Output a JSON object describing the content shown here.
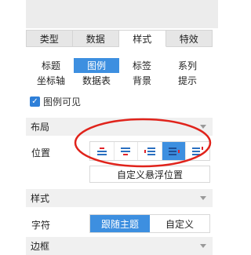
{
  "main_tabs": [
    "类型",
    "数据",
    "样式",
    "特效"
  ],
  "main_tab_active": "样式",
  "sub_tabs": [
    [
      "标题",
      "图例",
      "标签",
      "系列"
    ],
    [
      "坐标轴",
      "数据表",
      "背景",
      "提示"
    ]
  ],
  "sub_tab_active": "图例",
  "legend_visible": {
    "label": "图例可见",
    "checked": true
  },
  "layout_section": {
    "title": "布局",
    "position_label": "位置",
    "position_options": [
      "legend-top-icon",
      "legend-bottom-icon",
      "legend-left-icon",
      "legend-right-icon",
      "legend-top-right-icon"
    ],
    "position_selected": "legend-right-icon",
    "custom_float_label": "自定义悬浮位置"
  },
  "style_section": {
    "title": "样式",
    "font_label": "字符",
    "font_options": [
      "跟随主题",
      "自定义"
    ],
    "font_selected": "跟随主题"
  },
  "border_section": {
    "title": "边框"
  },
  "colors": {
    "accent": "#3d8fe0",
    "annotation": "#e0231b",
    "icon_red": "#e2232a",
    "icon_blue": "#2a6fc0"
  }
}
